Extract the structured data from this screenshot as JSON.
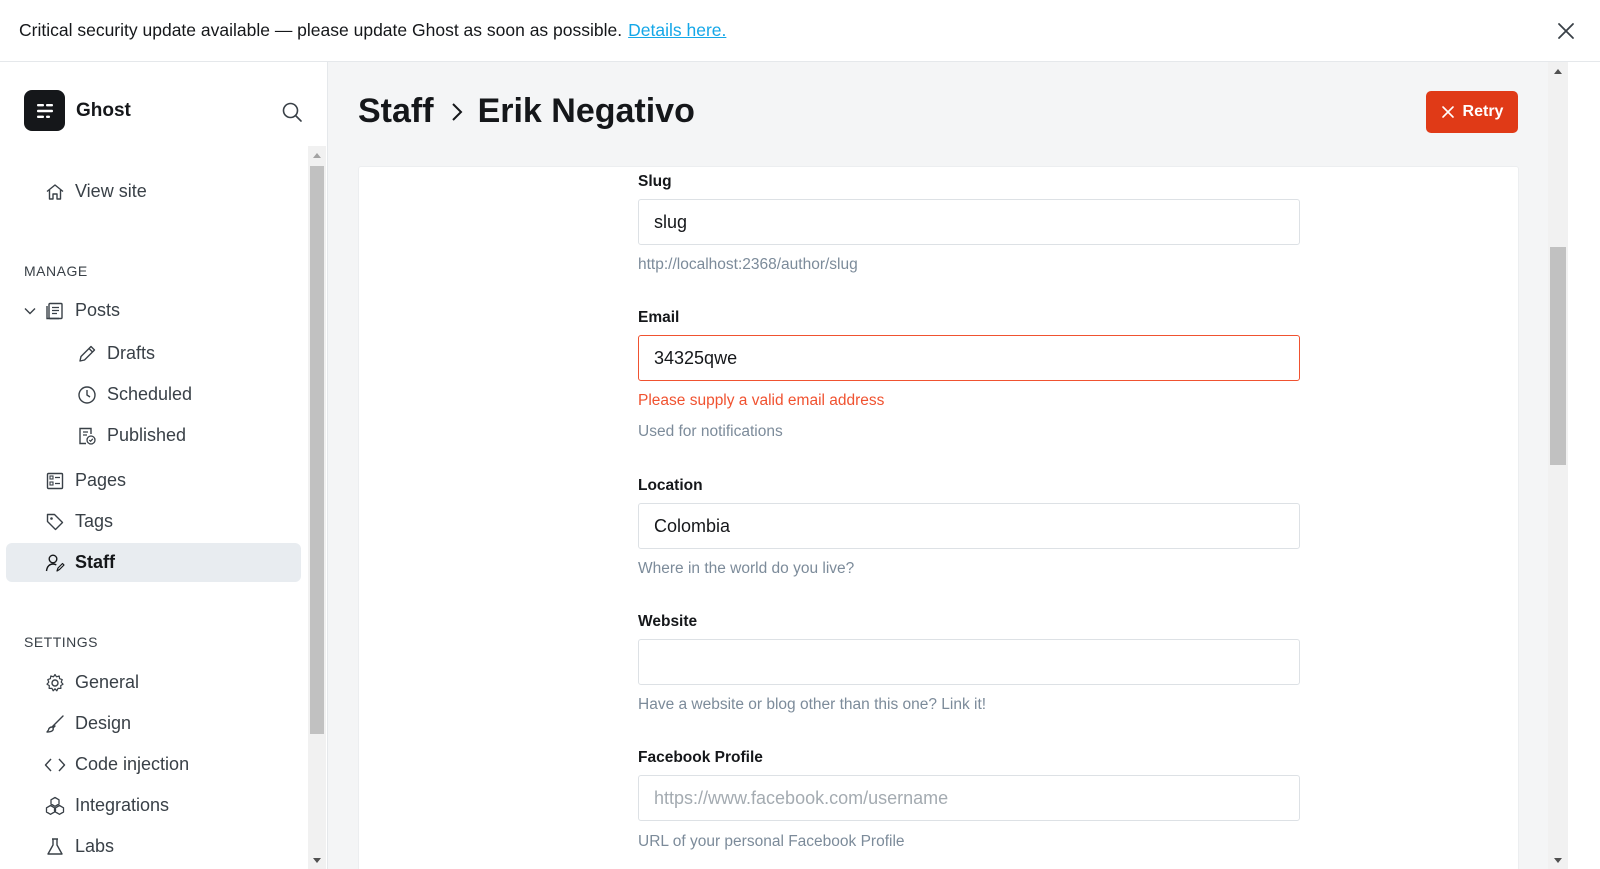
{
  "banner": {
    "message": "Critical security update available — please update Ghost as soon as possible.",
    "link_text": "Details here."
  },
  "brand": {
    "name": "Ghost"
  },
  "sidebar": {
    "view_site": "View site",
    "manage_heading": "MANAGE",
    "posts": "Posts",
    "drafts": "Drafts",
    "scheduled": "Scheduled",
    "published": "Published",
    "pages": "Pages",
    "tags": "Tags",
    "staff": "Staff",
    "settings_heading": "SETTINGS",
    "general": "General",
    "design": "Design",
    "code_injection": "Code injection",
    "integrations": "Integrations",
    "labs": "Labs"
  },
  "header": {
    "breadcrumb_parent": "Staff",
    "breadcrumb_current": "Erik Negativo",
    "retry_label": "Retry"
  },
  "form": {
    "slug": {
      "label": "Slug",
      "value": "slug",
      "hint": "http://localhost:2368/author/slug"
    },
    "email": {
      "label": "Email",
      "value": "34325qwe",
      "error": "Please supply a valid email address",
      "hint": "Used for notifications"
    },
    "location": {
      "label": "Location",
      "value": "Colombia",
      "hint": "Where in the world do you live?"
    },
    "website": {
      "label": "Website",
      "value": "",
      "hint": "Have a website or blog other than this one? Link it!"
    },
    "facebook": {
      "label": "Facebook Profile",
      "placeholder": "https://www.facebook.com/username",
      "hint": "URL of your personal Facebook Profile"
    }
  },
  "colors": {
    "accent_link": "#14a7e8",
    "danger": "#e03a17",
    "error_text": "#f05230",
    "active_nav_bg": "#e8ecf0"
  }
}
